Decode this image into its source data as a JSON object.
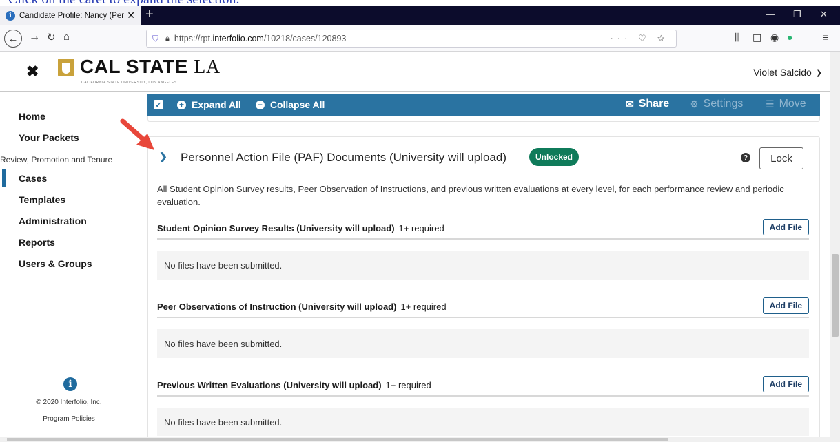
{
  "caption": {
    "text": "Click on the caret to expand the selection."
  },
  "browser": {
    "tab_title": "Candidate Profile: Nancy (Perfo",
    "tab_close": "✕",
    "new_tab": "+",
    "url_prefix": "https://rpt.",
    "url_domain": "interfolio.com",
    "url_path": "/10218/cases/120893",
    "url_actions": "··· ♡ ☆"
  },
  "header": {
    "close_icon": "✖",
    "logo_name": "CAL STATE",
    "logo_la": "LA",
    "logo_sub": "CALIFORNIA STATE UNIVERSITY, LOS ANGELES",
    "user_name": "Violet Salcido"
  },
  "sidebar": {
    "items": [
      {
        "label": "Home"
      },
      {
        "label": "Your Packets"
      },
      {
        "label": "Review, Promotion and Tenure"
      },
      {
        "label": "Cases"
      },
      {
        "label": "Templates"
      },
      {
        "label": "Administration"
      },
      {
        "label": "Reports"
      },
      {
        "label": "Users & Groups"
      }
    ],
    "copyright": "© 2020 Interfolio, Inc.",
    "policies": "Program Policies"
  },
  "toolbar": {
    "expand_all": "Expand All",
    "collapse_all": "Collapse All",
    "share": "Share",
    "settings": "Settings",
    "move": "Move"
  },
  "section": {
    "title": "Personnel Action File (PAF) Documents (University will upload)",
    "badge": "Unlocked",
    "lock_label": "Lock",
    "description": "All Student Opinion Survey results, Peer Observation of Instructions, and previous written evaluations at every level, for each performance review and periodic evaluation.",
    "subsections": [
      {
        "title": "Student Opinion Survey Results (University will upload)",
        "required": "1+ required",
        "add_file": "Add File",
        "empty": "No files have been submitted."
      },
      {
        "title": "Peer Observations of Instruction (University will upload)",
        "required": "1+ required",
        "add_file": "Add File",
        "empty": "No files have been submitted."
      },
      {
        "title": "Previous Written Evaluations (University will upload)",
        "required": "1+ required",
        "add_file": "Add File",
        "empty": "No files have been submitted."
      }
    ]
  },
  "colors": {
    "toolbar_blue": "#2a73a1",
    "badge_green": "#0f7b5a",
    "arrow_red": "#e8473a"
  }
}
